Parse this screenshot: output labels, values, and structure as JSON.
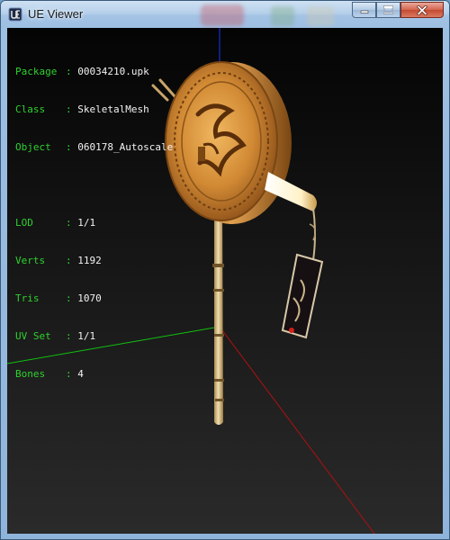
{
  "window": {
    "title": "UE Viewer",
    "controls": {
      "minimize": "minimize",
      "maximize": "maximize",
      "close": "close"
    }
  },
  "info": {
    "package_label": "Package",
    "package": "00034210.upk",
    "class_label": "Class",
    "class": "SkeletalMesh",
    "object_label": "Object",
    "object": "060178_Autoscale",
    "lod_label": "LOD",
    "lod": "1/1",
    "verts_label": "Verts",
    "verts": "1192",
    "tris_label": "Tris",
    "tris": "1070",
    "uvset_label": "UV Set",
    "uvset": "1/1",
    "bones_label": "Bones",
    "bones": "4",
    "separator": ":"
  },
  "colors": {
    "label": "#2fd12f",
    "value": "#f2f2f2",
    "axis_x": "#b01010",
    "axis_y": "#10c010",
    "axis_z": "#1030d0"
  },
  "icons": {
    "app": "ue-viewer-app-icon",
    "minimize": "minimize-icon",
    "maximize": "maximize-icon",
    "close": "close-icon"
  }
}
